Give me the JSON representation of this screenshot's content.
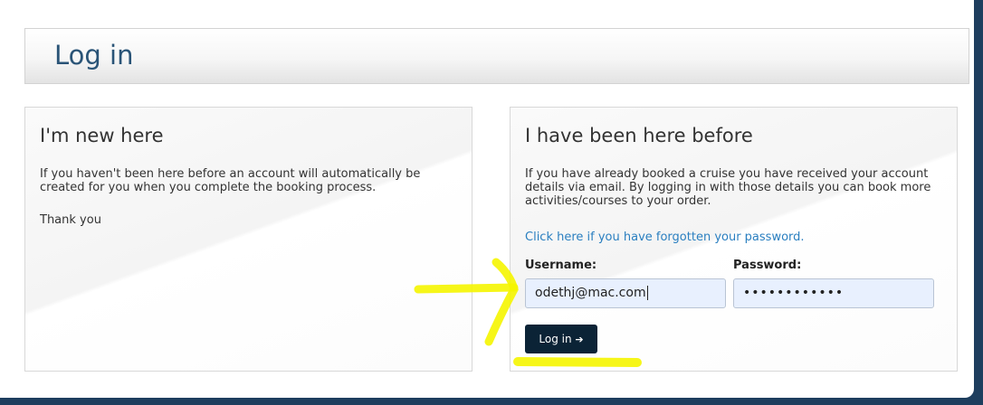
{
  "page_title": "Log in",
  "new_panel": {
    "heading": "I'm new here",
    "text": "If you haven't been here before an account will automatically be created for you when you complete the booking process.",
    "thanks": "Thank you"
  },
  "existing_panel": {
    "heading": "I have been here before",
    "text": "If you have already booked a cruise you have received your account details via email. By logging in with those details you can book more activities/courses to your order.",
    "forgot_link": "Click here if you have forgotten your password.",
    "username_label": "Username:",
    "password_label": "Password:",
    "username_value": "odethj@mac.com",
    "password_value": "••••••••••••",
    "login_button": "Log in",
    "login_icon": "➔"
  },
  "colors": {
    "heading_blue": "#2a5477",
    "link_blue": "#2a7fc0",
    "button_dark": "#0b2336",
    "highlight_yellow": "#f5f500"
  },
  "icons": [
    "sign-in-icon"
  ]
}
